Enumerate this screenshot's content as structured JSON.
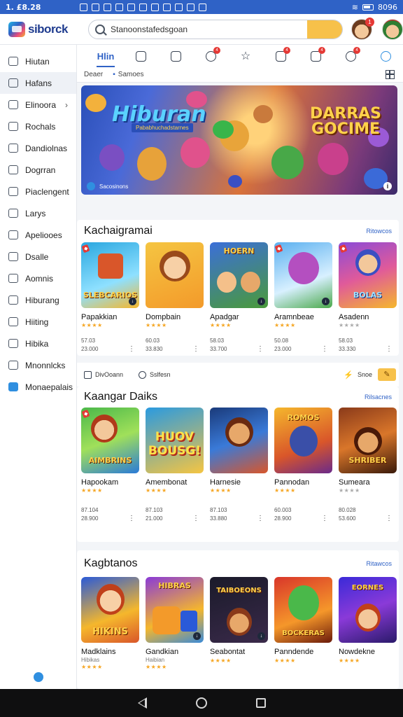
{
  "status": {
    "time": "1. £8.28",
    "battery": "8096"
  },
  "app": {
    "logo_text": "siborck",
    "search_value": "Stanoonstafedsgoan",
    "notification_count": "1"
  },
  "sidebar": {
    "items": [
      {
        "label": "Hiutan"
      },
      {
        "label": "Hafans"
      },
      {
        "label": "Elinoora"
      },
      {
        "label": "Rochals"
      },
      {
        "label": "Dandiolnas"
      },
      {
        "label": "Dogrran"
      },
      {
        "label": "Piaclengent"
      },
      {
        "label": "Larys"
      },
      {
        "label": "Apeliooes"
      },
      {
        "label": "Dsalle"
      },
      {
        "label": "Aomnis"
      },
      {
        "label": "Hiburang"
      },
      {
        "label": "Hiiting"
      },
      {
        "label": "Hibika"
      },
      {
        "label": "Mnonnlcks"
      },
      {
        "label": "Monaepalais"
      }
    ]
  },
  "tabs": {
    "active_label": "Hlin",
    "badges": [
      "4",
      "4",
      "4",
      "4"
    ]
  },
  "subrow": {
    "left": "Deaer",
    "right": "Samoes"
  },
  "banner": {
    "title_left": "Hiburan",
    "subtitle_left": "Pababhuchadstarnes",
    "title_right": "DARRAS GOCIME",
    "caption": "Sacosinons"
  },
  "sections": [
    {
      "title": "Kachaigramai",
      "more": "Ritowcos",
      "cards": [
        {
          "name": "Papakkian",
          "thumb_text": "SLEBCARIOS",
          "meta1": "57.03",
          "meta2": "23.000"
        },
        {
          "name": "Dompbain",
          "thumb_text": "",
          "meta1": "60.03",
          "meta2": "33.830"
        },
        {
          "name": "Apadgar",
          "thumb_text": "HOERN",
          "meta1": "58.03",
          "meta2": "33.700"
        },
        {
          "name": "Aramnbeae",
          "thumb_text": "",
          "meta1": "50.08",
          "meta2": "23.000"
        },
        {
          "name": "Asadenn",
          "thumb_text": "BOLAS",
          "meta1": "58.03",
          "meta2": "33.330"
        }
      ]
    },
    {
      "title": "Kaangar Daiks",
      "more": "Rilsacnes",
      "cards": [
        {
          "name": "Hapookam",
          "thumb_text": "AIMBRINS",
          "meta1": "87.104",
          "meta2": "28.900"
        },
        {
          "name": "Amembonat",
          "thumb_text": "HUOV BOUSG!",
          "meta1": "87.103",
          "meta2": "21.000"
        },
        {
          "name": "Harnesie",
          "thumb_text": "",
          "meta1": "87.103",
          "meta2": "33.880"
        },
        {
          "name": "Pannodan",
          "thumb_text": "ROMOS",
          "meta1": "60.003",
          "meta2": "28.900"
        },
        {
          "name": "Sumeara",
          "thumb_text": "SHRIBER",
          "meta1": "80.028",
          "meta2": "53.600"
        }
      ]
    },
    {
      "title": "Kagbtanos",
      "more": "Ritawcos",
      "cards": [
        {
          "name": "Madklains",
          "sub": "Hibikas",
          "thumb_text": "HIKINS"
        },
        {
          "name": "Gandkian",
          "sub": "Haibian",
          "thumb_text": "HIBRAS"
        },
        {
          "name": "Seabontat",
          "sub": "",
          "thumb_text": "TAIBOEONS"
        },
        {
          "name": "Panndende",
          "sub": "",
          "thumb_text": "BOCKERAS"
        },
        {
          "name": "Nowdekne",
          "sub": "",
          "thumb_text": "EORNES"
        }
      ]
    }
  ],
  "filterbar": {
    "left": "DivOoann",
    "middle": "Sslfesn",
    "right": "Snoe"
  },
  "stars": "★★★★",
  "colors": {
    "accent": "#2f62c6",
    "status_bar": "#2f62c6",
    "search_button": "#f7c14a",
    "badge": "#e53935"
  }
}
